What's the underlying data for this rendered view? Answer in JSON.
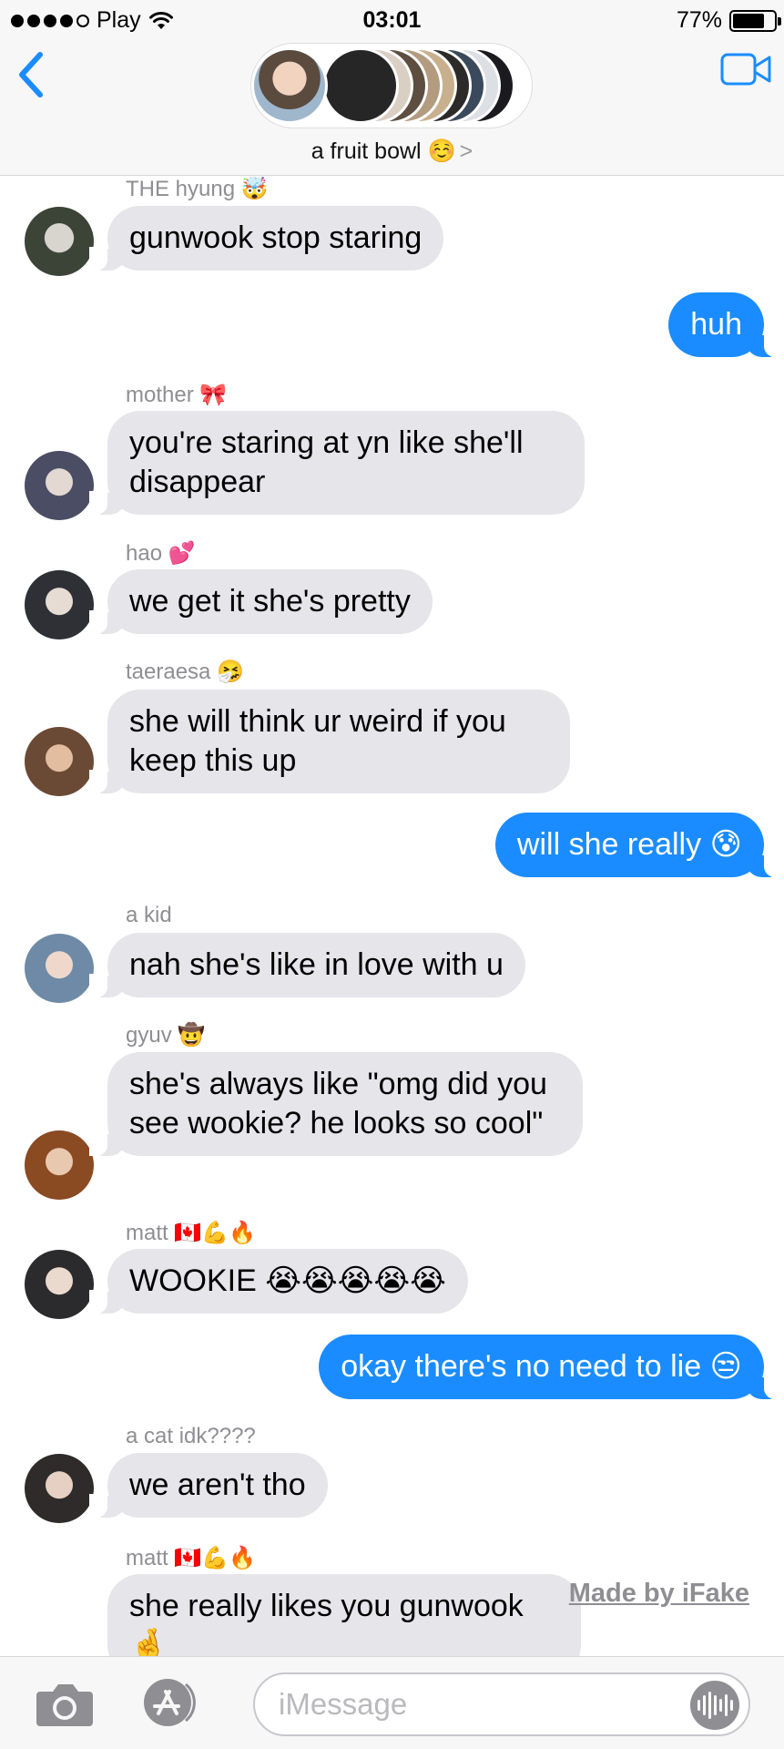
{
  "status_bar": {
    "carrier": "Play",
    "time": "03:01",
    "battery_percent": "77%",
    "battery_level": 0.77
  },
  "header": {
    "group_name": "a fruit bowl ☺️",
    "chevron": ">"
  },
  "colors": {
    "incoming": "#e5e5ea",
    "outgoing": "#1a8cff",
    "accent": "#1a8cff",
    "meta": "#8e8e93"
  },
  "messages": [
    {
      "sender": "THE hyung 🤯",
      "text": "gunwook stop staring"
    },
    {
      "text": "huh"
    },
    {
      "sender": "mother 🎀",
      "text": "you're staring at yn like she'll disappear"
    },
    {
      "sender": "hao 💕",
      "text": "we get it she's pretty"
    },
    {
      "sender": "taeraesa 🤧",
      "text": "she will think ur weird if you keep this up"
    },
    {
      "text": "will she really 😰"
    },
    {
      "sender": "a kid",
      "text": "nah she's like in love with u"
    },
    {
      "sender": "gyuv 🤠",
      "text": "she's always like \"omg did you see wookie? he looks so cool\""
    },
    {
      "sender": "matt 🇨🇦💪🔥",
      "text": "WOOKIE 😭😭😭😭😭"
    },
    {
      "text": "okay there's no need to lie 😒"
    },
    {
      "sender": "a cat idk????",
      "text": "we aren't tho"
    },
    {
      "sender": "matt 🇨🇦💪🔥",
      "text": "she really likes you gunwook 🤞"
    }
  ],
  "watermark": "Made by iFake",
  "input": {
    "placeholder": "iMessage"
  }
}
